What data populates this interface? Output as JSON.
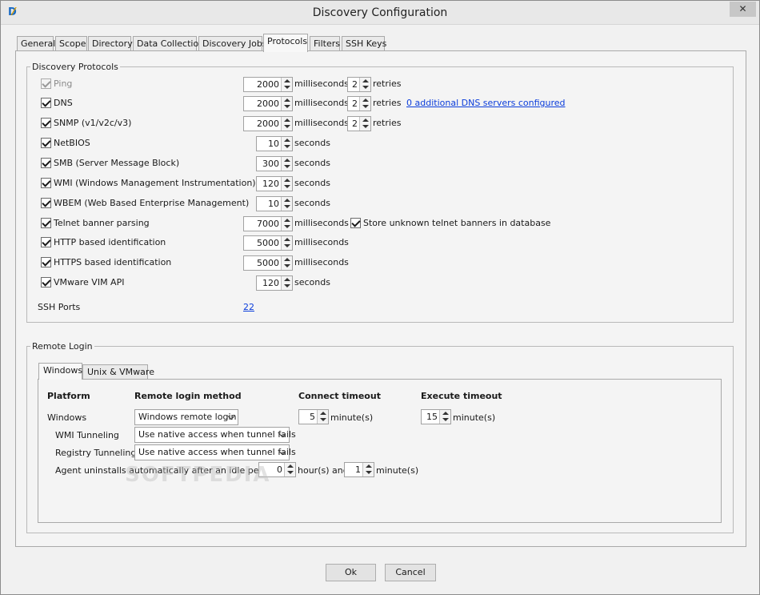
{
  "window": {
    "title": "Discovery Configuration",
    "close_glyph": "✕"
  },
  "tabs": [
    "General",
    "Scope",
    "Directory",
    "Data Collection",
    "Discovery Jobs",
    "Protocols",
    "Filters",
    "SSH Keys"
  ],
  "active_tab": "Protocols",
  "discovery_protocols": {
    "legend": "Discovery Protocols",
    "rows": [
      {
        "label": "Ping",
        "checked": true,
        "disabled": true,
        "timeout": "2000",
        "unit": "milliseconds",
        "retries": "2",
        "retries_label": "retries"
      },
      {
        "label": "DNS",
        "checked": true,
        "timeout": "2000",
        "unit": "milliseconds",
        "retries": "2",
        "retries_label": "retries",
        "link": "0 additional DNS servers configured"
      },
      {
        "label": "SNMP (v1/v2c/v3)",
        "checked": true,
        "timeout": "2000",
        "unit": "milliseconds",
        "retries": "2",
        "retries_label": "retries"
      },
      {
        "label": "NetBIOS",
        "checked": true,
        "timeout": "10",
        "unit": "seconds"
      },
      {
        "label": "SMB (Server Message Block)",
        "checked": true,
        "timeout": "300",
        "unit": "seconds"
      },
      {
        "label": "WMI (Windows Management Instrumentation)",
        "checked": true,
        "timeout": "120",
        "unit": "seconds"
      },
      {
        "label": "WBEM (Web Based Enterprise Management)",
        "checked": true,
        "timeout": "10",
        "unit": "seconds"
      },
      {
        "label": "Telnet banner parsing",
        "checked": true,
        "timeout": "7000",
        "unit": "milliseconds",
        "extra_checkbox": "Store unknown telnet banners in database"
      },
      {
        "label": "HTTP based identification",
        "checked": true,
        "timeout": "5000",
        "unit": "milliseconds"
      },
      {
        "label": "HTTPS based identification",
        "checked": true,
        "timeout": "5000",
        "unit": "milliseconds"
      },
      {
        "label": "VMware VIM API",
        "checked": true,
        "timeout": "120",
        "unit": "seconds"
      }
    ],
    "ssh_ports_label": "SSH Ports",
    "ssh_ports_value": "22"
  },
  "remote_login": {
    "legend": "Remote Login",
    "subtabs": [
      "Windows",
      "Unix & VMware"
    ],
    "active_subtab": "Windows",
    "headers": {
      "platform": "Platform",
      "method": "Remote login method",
      "connect": "Connect timeout",
      "execute": "Execute timeout"
    },
    "windows_label": "Windows",
    "windows_method": "Windows remote login",
    "connect_value": "5",
    "connect_unit": "minute(s)",
    "execute_value": "15",
    "execute_unit": "minute(s)",
    "wmi_tunneling_label": "WMI Tunneling",
    "wmi_tunneling_value": "Use native access when tunnel fails",
    "registry_tunneling_label": "Registry Tunneling",
    "registry_tunneling_value": "Use native access when tunnel fails",
    "agent_label": "Agent uninstalls automatically after an idle period of",
    "agent_hours": "0",
    "agent_hours_unit": "hour(s) and",
    "agent_minutes": "1",
    "agent_minutes_unit": "minute(s)"
  },
  "buttons": {
    "ok": "Ok",
    "cancel": "Cancel"
  },
  "watermark": "SOFTPEDIA"
}
